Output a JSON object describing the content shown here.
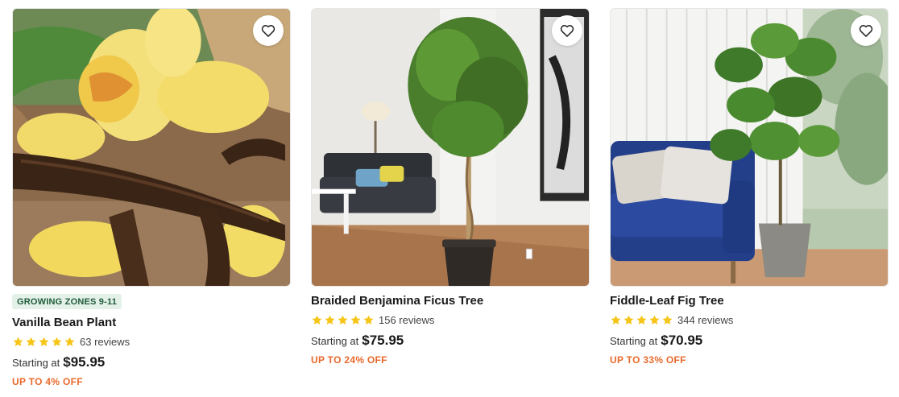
{
  "colors": {
    "star": "#f5c518",
    "discount": "#e8692c",
    "badge_bg": "#e3f1e8",
    "badge_text": "#1f5b3a"
  },
  "products": [
    {
      "badge": "GROWING ZONES 9-11",
      "title": "Vanilla Bean Plant",
      "rating": 5,
      "reviews": "63 reviews",
      "starting_label": "Starting at",
      "price": "$95.95",
      "discount": "UP TO 4% OFF",
      "image_icon": "vanilla-orchid-image",
      "wishlist_icon": "heart-icon"
    },
    {
      "title": "Braided Benjamina Ficus Tree",
      "rating": 5,
      "reviews": "156 reviews",
      "starting_label": "Starting at",
      "price": "$75.95",
      "discount": "UP TO 24% OFF",
      "image_icon": "ficus-tree-image",
      "wishlist_icon": "heart-icon"
    },
    {
      "title": "Fiddle-Leaf Fig Tree",
      "rating": 5,
      "reviews": "344 reviews",
      "starting_label": "Starting at",
      "price": "$70.95",
      "discount": "UP TO 33% OFF",
      "image_icon": "fiddle-leaf-fig-image",
      "wishlist_icon": "heart-icon"
    }
  ]
}
